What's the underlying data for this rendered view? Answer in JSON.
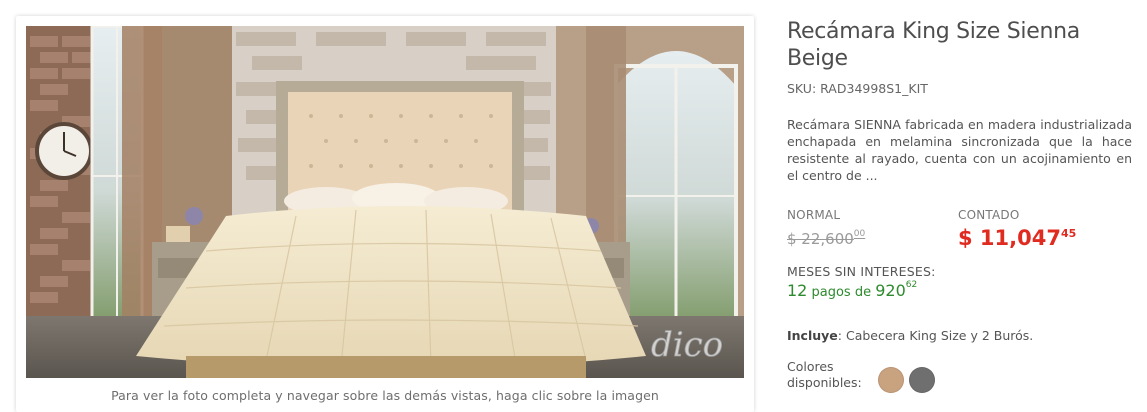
{
  "product": {
    "title": "Recámara King Size Sienna Beige",
    "sku": "SKU: RAD34998S1_KIT",
    "description": "Recámara SIENNA fabricada en madera industrializada enchapada en melamina sincronizada que la hace resistente al rayado, cuenta con un acojinamiento en el centro de ..."
  },
  "gallery": {
    "caption": "Para ver la foto completa y navegar sobre las demás vistas, haga clic sobre la imagen",
    "watermark": "dico"
  },
  "pricing": {
    "normal_label": "NORMAL",
    "normal_price": "$ 22,600",
    "normal_cents": "00",
    "contado_label": "CONTADO",
    "contado_price": "$ 11,047",
    "contado_cents": "45",
    "accent_color": "#e02b20"
  },
  "msi": {
    "label": "MESES SIN INTERESES:",
    "count": "12",
    "text": "pagos de",
    "amount": "920",
    "cents": "62",
    "color": "#2e8a2e"
  },
  "includes": {
    "label": "Incluye",
    "text": ": Cabecera King Size y 2 Burós."
  },
  "colors": {
    "label": "Colores disponibles:",
    "swatches": [
      {
        "name": "beige",
        "hex": "#c9a27f"
      },
      {
        "name": "gris",
        "hex": "#6f6f6f"
      }
    ]
  }
}
